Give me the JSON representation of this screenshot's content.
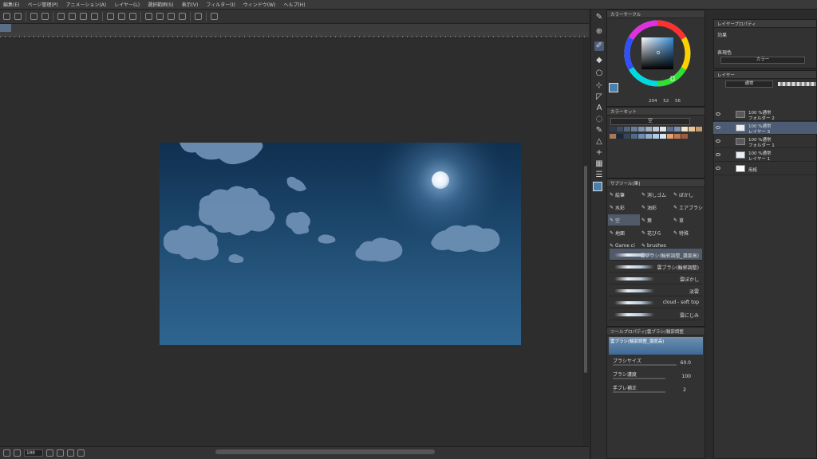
{
  "menu": [
    "編集(E)",
    "ページ管理(P)",
    "アニメーション(A)",
    "レイヤー(L)",
    "選択範囲(S)",
    "表示(V)",
    "フィルター(I)",
    "ウィンドウ(W)",
    "ヘルプ(H)"
  ],
  "status": {
    "zoom": "100"
  },
  "color_wheel": {
    "title": "カラーサークル",
    "h_value": "204",
    "s_value": "52",
    "v_value": "56",
    "main_color": "#4a7fb0",
    "sub_color": "#ffffff"
  },
  "color_set": {
    "title": "カラーセット",
    "set_name": "空",
    "swatches": [
      "#2e3a4e",
      "#3d4d66",
      "#52647e",
      "#6a7e98",
      "#8396ae",
      "#a2b1c4",
      "#c1ccd8",
      "#e0e6ec",
      "#5b6f8f",
      "#7c90b0",
      "#f2e6c8",
      "#e8c89a",
      "#c89a6e",
      "#a87a5a",
      "#1c2838",
      "#34465e",
      "#4f6a8a",
      "#6f8eb0",
      "#8fb0d0",
      "#b0cce6",
      "#d8e6f2",
      "#e4a070",
      "#c07850",
      "#9c5e40"
    ]
  },
  "subtool_panel": {
    "title": "サブツール[筆]",
    "items": [
      {
        "label": "絵筆",
        "selected": false
      },
      {
        "label": "消しゴム",
        "selected": false
      },
      {
        "label": "ぼかし",
        "selected": false
      },
      {
        "label": "水彩",
        "selected": false
      },
      {
        "label": "油彩",
        "selected": false
      },
      {
        "label": "エアブラシ",
        "selected": false
      },
      {
        "label": "空",
        "selected": true
      },
      {
        "label": "葉",
        "selected": false
      },
      {
        "label": "草",
        "selected": false
      },
      {
        "label": "地面",
        "selected": false
      },
      {
        "label": "花びら",
        "selected": false
      },
      {
        "label": "特殊",
        "selected": false
      },
      {
        "label": "Game ci",
        "selected": false
      },
      {
        "label": "brushes",
        "selected": false
      }
    ],
    "brushes": [
      {
        "name": "雲ブラシ(輪郭調整_濃度高)",
        "selected": true
      },
      {
        "name": "雲ブラシ(輪郭調整)",
        "selected": false
      },
      {
        "name": "雲ぼかし",
        "selected": false
      },
      {
        "name": "淡雲",
        "selected": false
      },
      {
        "name": "cloud - soft top",
        "selected": false
      },
      {
        "name": "雲にじみ",
        "selected": false
      }
    ]
  },
  "tool_property": {
    "title": "ツールプロパティ[雲ブラシ(輪郭調整",
    "preset_name": "雲ブラシ(輪郭調整_濃度高)",
    "brush_size_label": "ブラシサイズ",
    "brush_size_value": "60.0",
    "brush_density_label": "ブラシ濃度",
    "brush_density_value": "100",
    "stabilization_label": "手ブレ補正",
    "stabilization_value": "2"
  },
  "layer_property": {
    "title": "レイヤープロパティ",
    "effect_label": "効果",
    "color_label": "表現色",
    "color_value": "カラー"
  },
  "layer_panel": {
    "title": "レイヤー",
    "blend_mode": "通常",
    "layers": [
      {
        "opacity_mode": "100 %通常",
        "name": "フォルダー 2",
        "type": "folder",
        "selected": false
      },
      {
        "opacity_mode": "100 %通常",
        "name": "レイヤー 3",
        "type": "layer",
        "selected": true
      },
      {
        "opacity_mode": "100 %通常",
        "name": "フォルダー 1",
        "type": "folder",
        "selected": false
      },
      {
        "opacity_mode": "100 %通常",
        "name": "レイヤー 1",
        "type": "layer",
        "selected": false
      },
      {
        "opacity_mode": "",
        "name": "用紙",
        "type": "paper",
        "selected": false
      }
    ]
  }
}
